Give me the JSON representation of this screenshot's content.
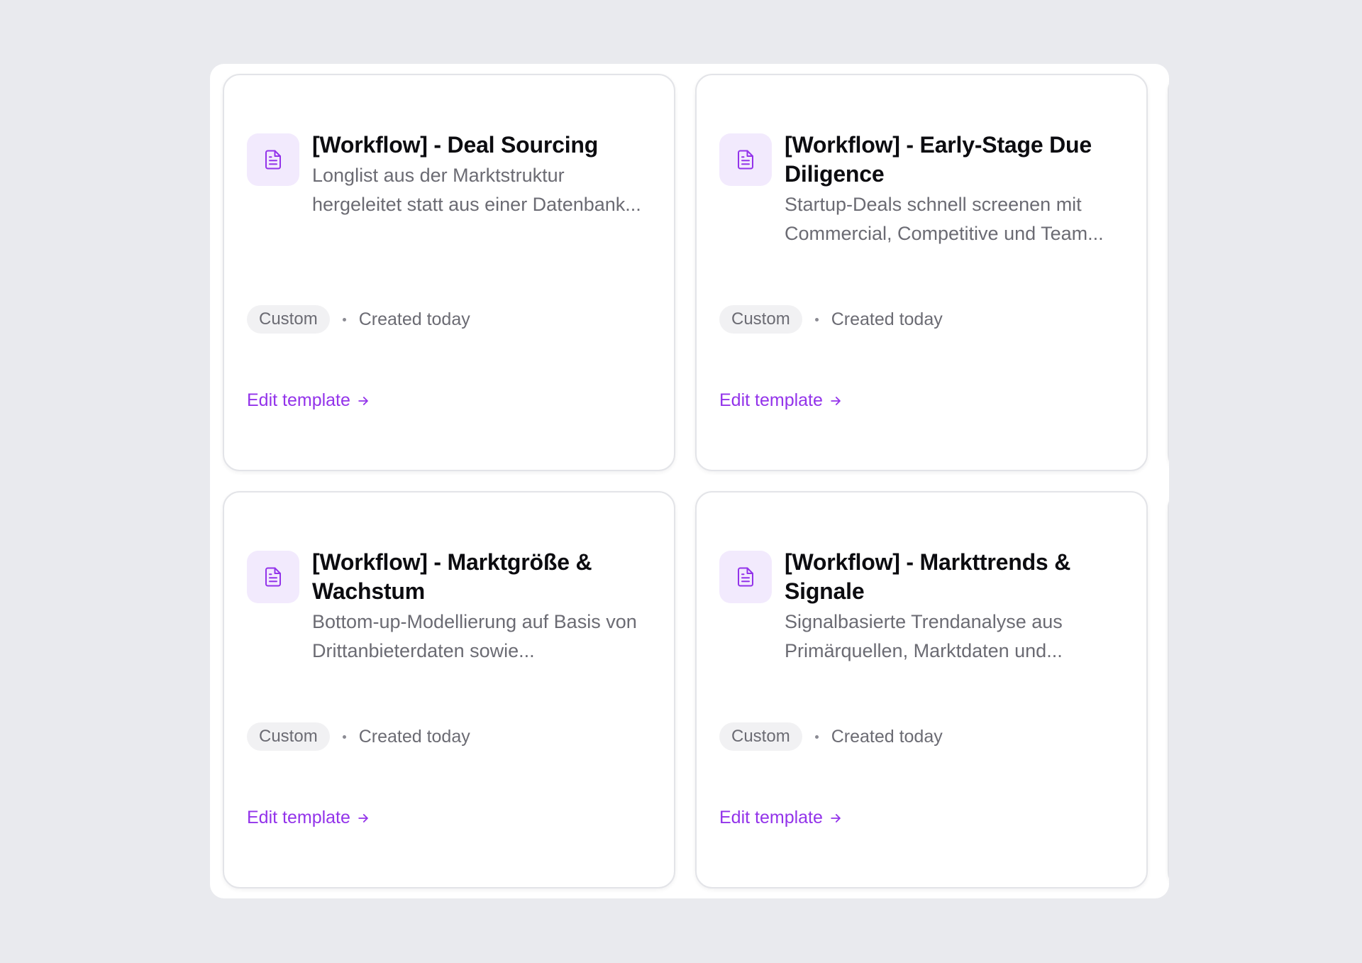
{
  "templates": [
    {
      "title": "[Workflow] - Deal Sourcing",
      "description": "Longlist aus der Marktstruktur hergeleitet statt aus einer Datenbank...",
      "tag": "Custom",
      "created": "Created today",
      "action": "Edit template",
      "icon": "document-icon"
    },
    {
      "title": "[Workflow] - Early-Stage Due Diligence",
      "description": "Startup-Deals schnell screenen mit Commercial, Competitive und Team...",
      "tag": "Custom",
      "created": "Created today",
      "action": "Edit template",
      "icon": "document-icon"
    },
    {
      "title": "[Workflow] - Marktgröße & Wachstum",
      "description": "Bottom-up-Modellierung auf Basis von Drittanbieterdaten sowie...",
      "tag": "Custom",
      "created": "Created today",
      "action": "Edit template",
      "icon": "document-icon"
    },
    {
      "title": "[Workflow] - Markttrends & Signale",
      "description": "Signalbasierte Trendanalyse aus Primärquellen, Marktdaten und...",
      "tag": "Custom",
      "created": "Created today",
      "action": "Edit template",
      "icon": "document-icon"
    }
  ],
  "colors": {
    "accent": "#9333ea",
    "icon_bg": "#f2eafd",
    "page_bg": "#e9eaee",
    "tag_bg": "#f1f1f3",
    "muted_text": "#6b6b73"
  }
}
